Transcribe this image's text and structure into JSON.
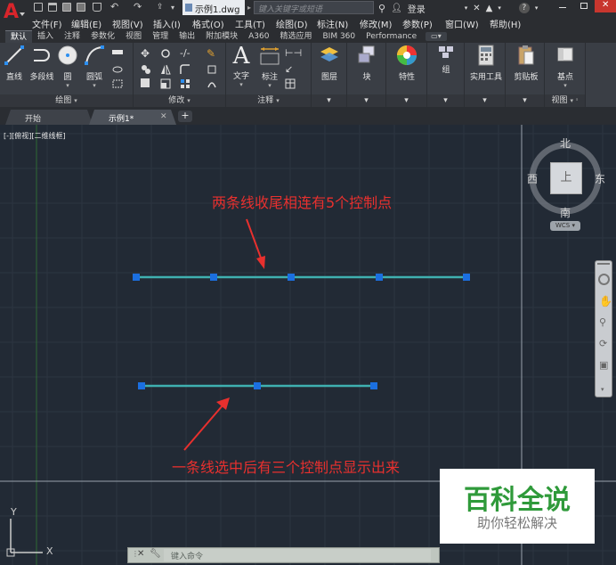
{
  "title_bar": {
    "document_name": "示例1.dwg",
    "search_placeholder": "键入关键字或短语",
    "login_label": "登录",
    "help_icon": "?"
  },
  "menu": [
    "文件(F)",
    "编辑(E)",
    "视图(V)",
    "插入(I)",
    "格式(O)",
    "工具(T)",
    "绘图(D)",
    "标注(N)",
    "修改(M)",
    "参数(P)",
    "窗口(W)",
    "帮助(H)"
  ],
  "ribbon_tabs": [
    "默认",
    "插入",
    "注释",
    "参数化",
    "视图",
    "管理",
    "输出",
    "附加模块",
    "A360",
    "精选应用",
    "BIM 360",
    "Performance"
  ],
  "ribbon": {
    "draw_panel": "绘图",
    "modify_panel": "修改",
    "annotation_panel": "注释",
    "view_panel": "视图",
    "buttons": {
      "line": "直线",
      "polyline": "多段线",
      "circle": "圆",
      "arc": "圆弧",
      "text": "文字",
      "dimension": "标注",
      "layers": "图层",
      "block": "块",
      "properties": "特性",
      "groups": "组",
      "utilities": "实用工具",
      "clipboard": "剪贴板",
      "base": "基点"
    }
  },
  "file_tabs": [
    "开始",
    "示例1*"
  ],
  "viewport_label": "[-][俯视][二维线框]",
  "viewcube": {
    "north": "北",
    "south": "南",
    "east": "东",
    "west": "西",
    "face": "上",
    "wcs": "WCS"
  },
  "annotations": {
    "top": "两条线收尾相连有5个控制点",
    "bottom": "一条线选中后有三个控制点显示出来"
  },
  "ucs": {
    "x": "X",
    "y": "Y"
  },
  "command_line": {
    "placeholder": "键入命令"
  },
  "watermark": {
    "title": "百科全说",
    "subtitle": "助你轻松解决"
  },
  "colors": {
    "accent_red": "#d8252b",
    "grip_blue": "#1b6fe0",
    "line_cyan": "#3fb0b0",
    "annotation_red": "#e8302e",
    "watermark_green": "#2f9a3a"
  }
}
